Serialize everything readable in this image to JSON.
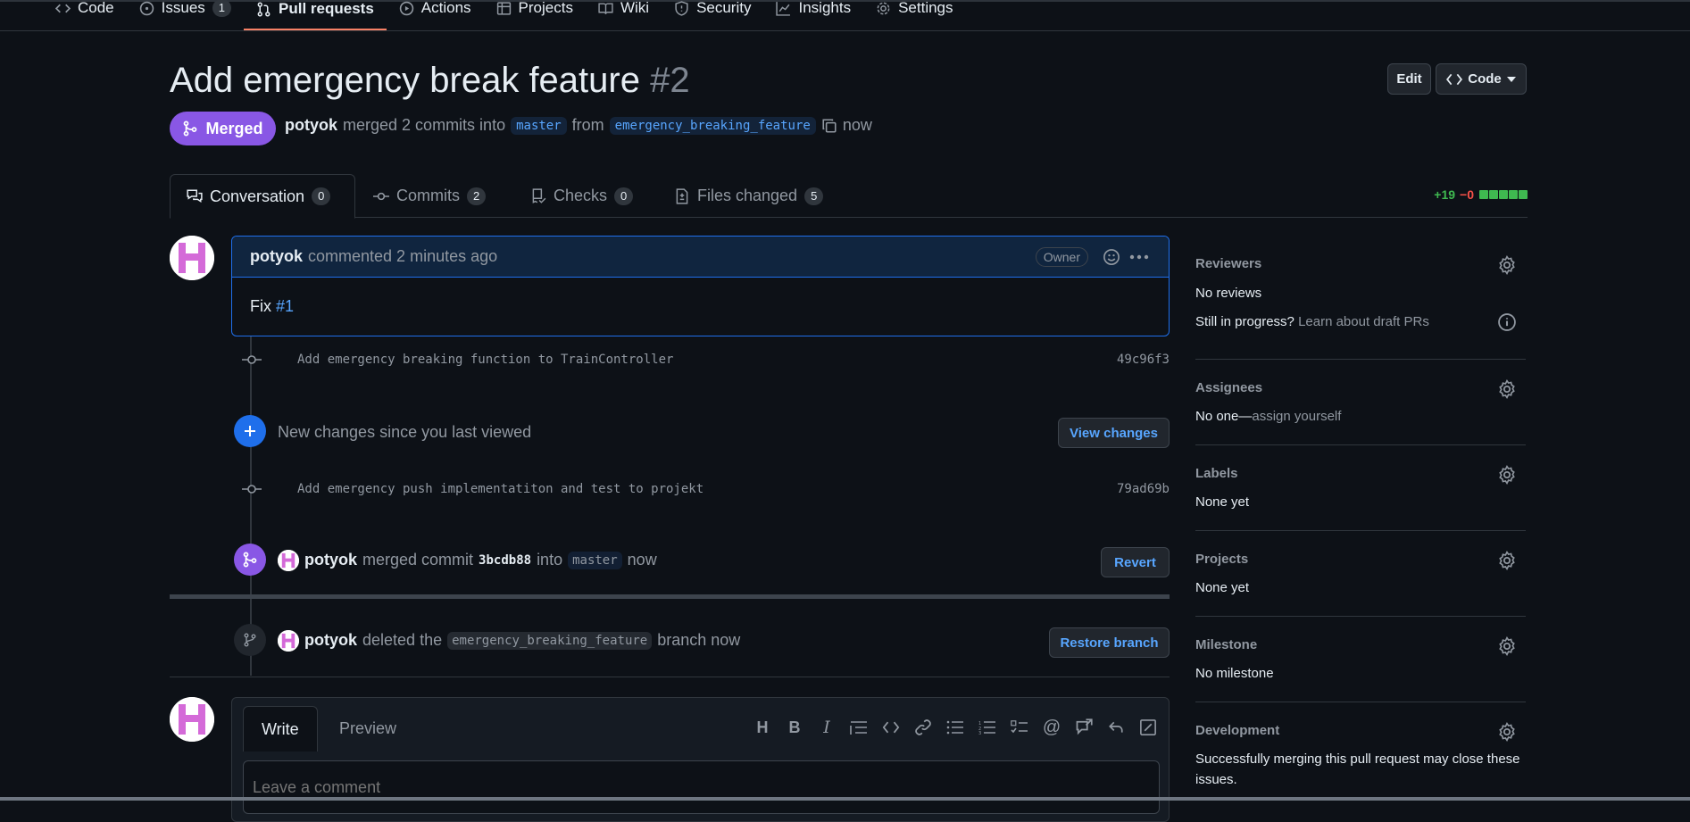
{
  "repo_nav": {
    "tabs": [
      {
        "label": "Code"
      },
      {
        "label": "Issues",
        "count": "1"
      },
      {
        "label": "Pull requests"
      },
      {
        "label": "Actions"
      },
      {
        "label": "Projects"
      },
      {
        "label": "Wiki"
      },
      {
        "label": "Security"
      },
      {
        "label": "Insights"
      },
      {
        "label": "Settings"
      }
    ]
  },
  "pr": {
    "title": "Add emergency break feature",
    "number": "#2",
    "edit_label": "Edit",
    "code_label": "Code",
    "state": "Merged",
    "author": "potyok",
    "merged_text": "merged 2 commits into",
    "base_branch": "master",
    "from_text": "from",
    "head_branch": "emergency_breaking_feature",
    "time": "now"
  },
  "pr_tabs": [
    {
      "label": "Conversation",
      "count": "0"
    },
    {
      "label": "Commits",
      "count": "2"
    },
    {
      "label": "Checks",
      "count": "0"
    },
    {
      "label": "Files changed",
      "count": "5"
    }
  ],
  "diffstat": {
    "additions": "+19",
    "deletions": "−0"
  },
  "comment": {
    "author": "potyok",
    "action": "commented 2 minutes ago",
    "badge": "Owner",
    "body_text": "Fix",
    "body_link": "#1"
  },
  "commits": [
    {
      "message": "Add emergency breaking function to TrainController",
      "sha": "49c96f3"
    },
    {
      "message": "Add emergency push implementatiton and test to projekt",
      "sha": "79ad69b"
    }
  ],
  "new_changes": {
    "text": "New changes since you last viewed",
    "button": "View changes"
  },
  "merge_event": {
    "author": "potyok",
    "text1": "merged commit",
    "sha": "3bcdb88",
    "text2": "into",
    "branch": "master",
    "time": "now",
    "button": "Revert"
  },
  "delete_event": {
    "author": "potyok",
    "text1": "deleted the",
    "branch": "emergency_breaking_feature",
    "text2": "branch now",
    "button": "Restore branch"
  },
  "write": {
    "write_tab": "Write",
    "preview_tab": "Preview",
    "placeholder": "Leave a comment"
  },
  "sidebar": {
    "reviewers": {
      "title": "Reviewers",
      "value": "No reviews",
      "draft_q": "Still in progress?",
      "draft_link": "Learn about draft PRs"
    },
    "assignees": {
      "title": "Assignees",
      "value": "No one—",
      "link": "assign yourself"
    },
    "labels": {
      "title": "Labels",
      "value": "None yet"
    },
    "projects": {
      "title": "Projects",
      "value": "None yet"
    },
    "milestone": {
      "title": "Milestone",
      "value": "No milestone"
    },
    "development": {
      "title": "Development",
      "value_line1": "Successfully merging this pull request may close these",
      "value_line2": "issues."
    }
  },
  "colors": {
    "merged": "#8957e5",
    "link": "#58a6ff",
    "add": "#3fb950",
    "del": "#f85149"
  }
}
